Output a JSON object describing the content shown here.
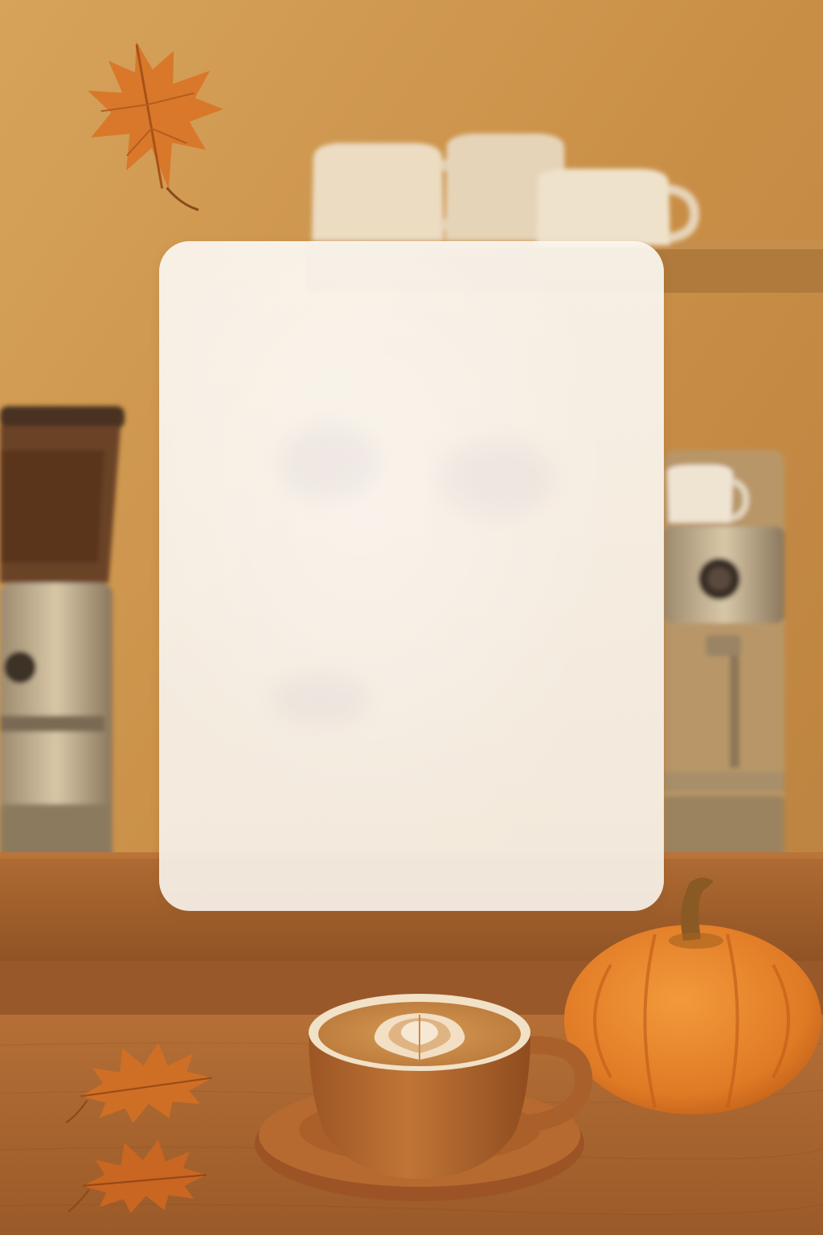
{
  "scene": {
    "description_tag": "autumn-cafe-background",
    "palette": {
      "wall": "#c98e46",
      "shelf": "#b07a3c",
      "counter": "#a35f2c",
      "mug": "#f0e2cc",
      "cup": "#b76a2f",
      "latte": "#c98543",
      "foam": "#f6e8d2",
      "pumpkin": "#e07a25",
      "pumpkin_dark": "#c25f17",
      "stem": "#8a5a24",
      "leaf": "#d9782a",
      "card": "#f7f1ea"
    }
  }
}
